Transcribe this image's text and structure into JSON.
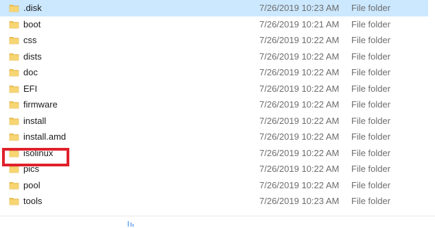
{
  "file_list": {
    "items": [
      {
        "name": ".disk",
        "date_modified": "7/26/2019 10:23 AM",
        "type": "File folder",
        "icon": "folder-icon",
        "selected": true
      },
      {
        "name": "boot",
        "date_modified": "7/26/2019 10:21 AM",
        "type": "File folder",
        "icon": "folder-icon"
      },
      {
        "name": "css",
        "date_modified": "7/26/2019 10:22 AM",
        "type": "File folder",
        "icon": "folder-icon"
      },
      {
        "name": "dists",
        "date_modified": "7/26/2019 10:22 AM",
        "type": "File folder",
        "icon": "folder-icon"
      },
      {
        "name": "doc",
        "date_modified": "7/26/2019 10:22 AM",
        "type": "File folder",
        "icon": "folder-icon"
      },
      {
        "name": "EFI",
        "date_modified": "7/26/2019 10:22 AM",
        "type": "File folder",
        "icon": "folder-icon"
      },
      {
        "name": "firmware",
        "date_modified": "7/26/2019 10:22 AM",
        "type": "File folder",
        "icon": "folder-icon"
      },
      {
        "name": "install",
        "date_modified": "7/26/2019 10:22 AM",
        "type": "File folder",
        "icon": "folder-icon"
      },
      {
        "name": "install.amd",
        "date_modified": "7/26/2019 10:22 AM",
        "type": "File folder",
        "icon": "folder-icon"
      },
      {
        "name": "isolinux",
        "date_modified": "7/26/2019 10:22 AM",
        "type": "File folder",
        "icon": "folder-icon",
        "highlighted": true
      },
      {
        "name": "pics",
        "date_modified": "7/26/2019 10:22 AM",
        "type": "File folder",
        "icon": "folder-icon"
      },
      {
        "name": "pool",
        "date_modified": "7/26/2019 10:22 AM",
        "type": "File folder",
        "icon": "folder-icon"
      },
      {
        "name": "tools",
        "date_modified": "7/26/2019 10:23 AM",
        "type": "File folder",
        "icon": "folder-icon"
      }
    ]
  },
  "colors": {
    "selection": "#cce8ff",
    "highlight_box": "#e0202a",
    "folder": "#f2c75c",
    "secondary_text": "#6d6d6d"
  }
}
